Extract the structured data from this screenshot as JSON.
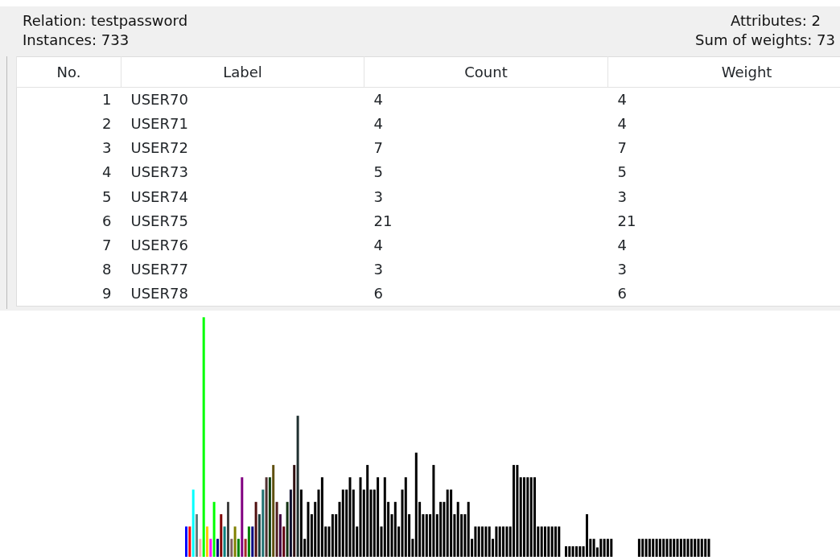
{
  "summary": {
    "left": [
      {
        "label": "Relation:",
        "value": "testpassword"
      },
      {
        "label": "Instances:",
        "value": "733"
      }
    ],
    "right": [
      {
        "label": "Attributes:",
        "value": "2"
      },
      {
        "label": "Sum of weights:",
        "value": "73"
      }
    ]
  },
  "table": {
    "columns": [
      "No.",
      "Label",
      "Count",
      "Weight"
    ],
    "rows": [
      {
        "no": "1",
        "label": "USER70",
        "count": "4",
        "weight": "4"
      },
      {
        "no": "2",
        "label": "USER71",
        "count": "4",
        "weight": "4"
      },
      {
        "no": "3",
        "label": "USER72",
        "count": "7",
        "weight": "7"
      },
      {
        "no": "4",
        "label": "USER73",
        "count": "5",
        "weight": "5"
      },
      {
        "no": "5",
        "label": "USER74",
        "count": "3",
        "weight": "3"
      },
      {
        "no": "6",
        "label": "USER75",
        "count": "21",
        "weight": "21"
      },
      {
        "no": "7",
        "label": "USER76",
        "count": "4",
        "weight": "4"
      },
      {
        "no": "8",
        "label": "USER77",
        "count": "3",
        "weight": "3"
      },
      {
        "no": "9",
        "label": "USER78",
        "count": "6",
        "weight": "6"
      }
    ]
  }
}
